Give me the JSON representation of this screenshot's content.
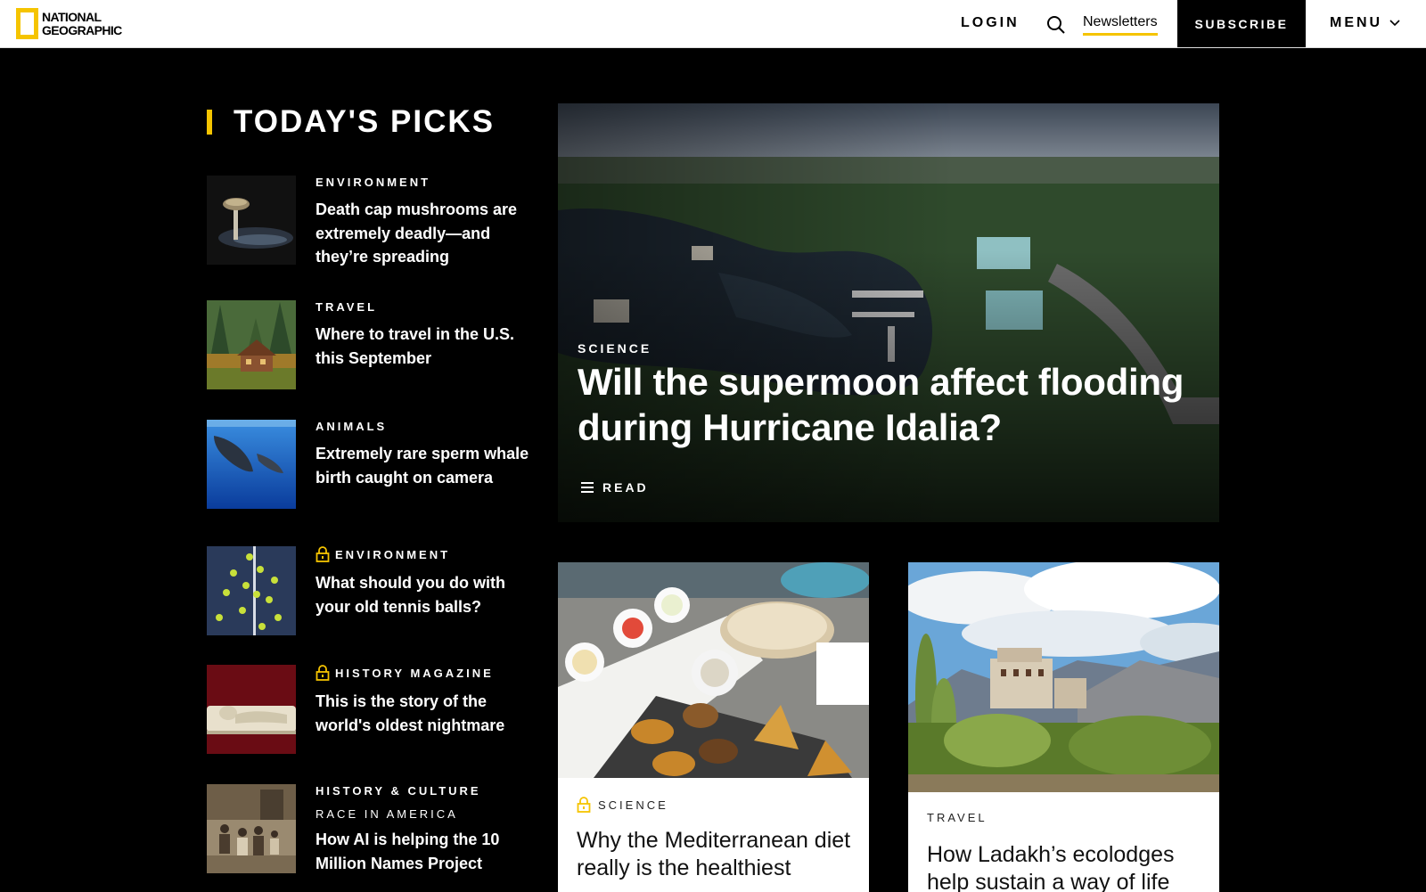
{
  "header": {
    "logo_line1": "NATIONAL",
    "logo_line2": "GEOGRAPHIC",
    "login": "LOGIN",
    "newsletters": "Newsletters",
    "subscribe": "SUBSCRIBE",
    "menu": "MENU"
  },
  "picks": {
    "title": "TODAY'S PICKS",
    "items": [
      {
        "kicker": "ENVIRONMENT",
        "headline": "Death cap mushrooms are extremely deadly—and they’re spreading",
        "locked": false,
        "thumb_icon": "mushroom-photo"
      },
      {
        "kicker": "TRAVEL",
        "headline": "Where to travel in the U.S. this September",
        "locked": false,
        "thumb_icon": "cabin-forest-photo"
      },
      {
        "kicker": "ANIMALS",
        "headline": "Extremely rare sperm whale birth caught on camera",
        "locked": false,
        "thumb_icon": "sperm-whale-photo"
      },
      {
        "kicker": "ENVIRONMENT",
        "headline": "What should you do with your old tennis balls?",
        "locked": true,
        "thumb_icon": "tennis-balls-photo"
      },
      {
        "kicker": "HISTORY MAGAZINE",
        "headline": "This is the story of the world's oldest nightmare",
        "locked": true,
        "thumb_icon": "carved-relief-photo"
      },
      {
        "kicker": "HISTORY & CULTURE",
        "subkicker": "RACE IN AMERICA",
        "headline": "How AI is helping the 10 Million Names Project",
        "locked": false,
        "thumb_icon": "historic-family-photo"
      }
    ]
  },
  "hero": {
    "kicker": "SCIENCE",
    "title": "Will the supermoon affect flooding during Hurricane Idalia?",
    "read_label": "READ",
    "image_icon": "aerial-coastal-town-photo"
  },
  "cards": [
    {
      "kicker": "SCIENCE",
      "title": "Why the Mediterranean diet really is the healthiest",
      "locked": true,
      "image_icon": "mediterranean-food-photo"
    },
    {
      "kicker": "TRAVEL",
      "title": "How Ladakh’s ecolodges help sustain a way of life",
      "locked": false,
      "image_icon": "ladakh-monastery-photo"
    }
  ],
  "colors": {
    "accent": "#f5c400",
    "background": "#000000",
    "header_bg": "#ffffff"
  }
}
